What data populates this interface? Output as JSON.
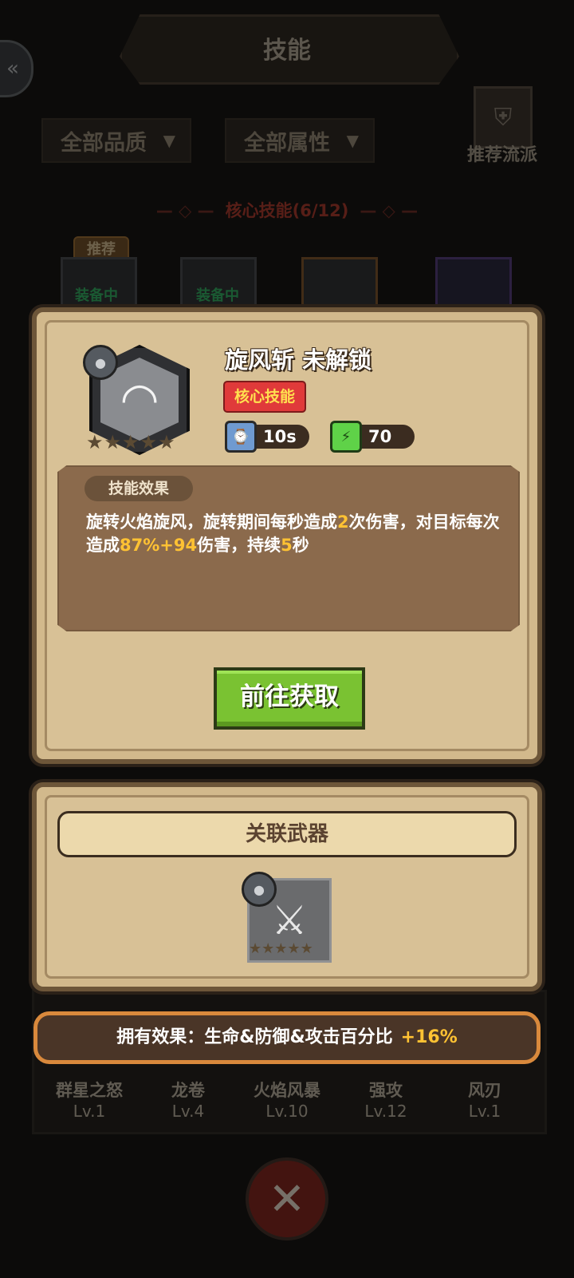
{
  "background": {
    "title": "技能",
    "filters": {
      "quality": "全部品质",
      "attribute": "全部属性"
    },
    "recommend_label": "推荐流派",
    "core_heading": "核心技能(6/12)",
    "recommend_tag": "推荐",
    "equipped_label": "装备中",
    "bottom_skills": [
      {
        "name": "群星之怒",
        "level": "Lv.1"
      },
      {
        "name": "龙卷",
        "level": "Lv.4"
      },
      {
        "name": "火焰风暴",
        "level": "Lv.10"
      },
      {
        "name": "强攻",
        "level": "Lv.12"
      },
      {
        "name": "风刃",
        "level": "Lv.1"
      }
    ]
  },
  "popup": {
    "skill_name": "旋风斩 未解锁",
    "core_badge": "核心技能",
    "stats": {
      "cooldown": "10s",
      "energy": "70"
    },
    "stars_filled": 0,
    "stars_total": 5,
    "effect_tab": "技能效果",
    "effect_parts": [
      "旋转火焰旋风，旋转期间每秒造成",
      "2",
      "次伤害，对目标每次造成",
      "87%+94",
      "伤害，持续",
      "5",
      "秒"
    ],
    "go_button": "前往获取",
    "weapon_header": "关联武器",
    "own_effect": {
      "label": "拥有效果：生命&防御&攻击百分比",
      "value": "+16%"
    }
  },
  "icons": {
    "back": "double-chevron-left-icon",
    "skill": "whirlwind-icon",
    "lock": "lock-icon",
    "time": "clock-icon",
    "energy": "lightning-icon",
    "weapon": "claw-weapon-icon",
    "close": "close-icon"
  },
  "colors": {
    "core_badge": "#e03a3a",
    "highlight": "#ffc233",
    "go_button": "#7ac232",
    "own_bar_border": "#d9893c"
  }
}
